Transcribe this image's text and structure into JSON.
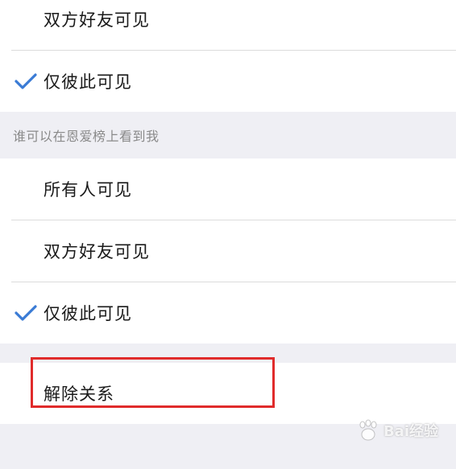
{
  "group_top": {
    "items": [
      {
        "label": "双方好友可见",
        "checked": false
      },
      {
        "label": "仅彼此可见",
        "checked": true
      }
    ]
  },
  "section": {
    "title": "谁可以在恩爱榜上看到我",
    "items": [
      {
        "label": "所有人可见",
        "checked": false
      },
      {
        "label": "双方好友可见",
        "checked": false
      },
      {
        "label": "仅彼此可见",
        "checked": true
      }
    ]
  },
  "action": {
    "label": "解除关系"
  },
  "watermark": {
    "text": "Bai经验"
  },
  "colors": {
    "check": "#3a7bd5",
    "highlight": "#e02b2b",
    "page_bg": "#efeff4"
  }
}
